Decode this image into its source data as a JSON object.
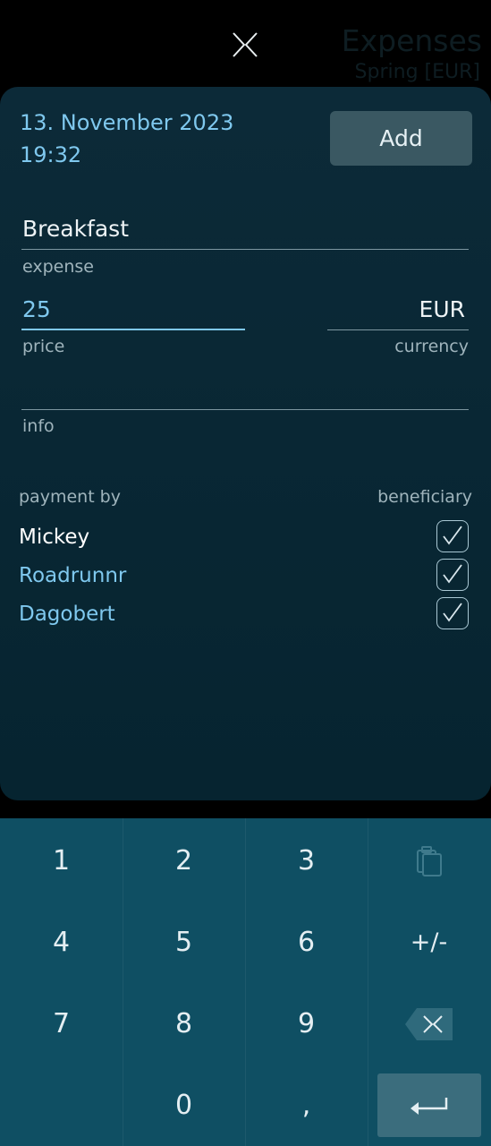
{
  "header": {
    "title": "Expenses",
    "subtitle": "Spring [EUR]",
    "close_icon": "close-icon"
  },
  "dialog": {
    "date": "13. November 2023",
    "time": "19:32",
    "add_label": "Add",
    "expense": {
      "value": "Breakfast",
      "label": "expense"
    },
    "price": {
      "value": "25",
      "label": "price"
    },
    "currency": {
      "value": "EUR",
      "label": "currency"
    },
    "info": {
      "value": "",
      "label": "info"
    },
    "payment_by_label": "payment by",
    "beneficiary_label": "beneficiary",
    "people": [
      {
        "name": "Mickey",
        "payer": true,
        "beneficiary": true
      },
      {
        "name": "Roadrunnr",
        "payer": false,
        "beneficiary": true
      },
      {
        "name": "Dagobert",
        "payer": false,
        "beneficiary": true
      }
    ]
  },
  "keypad": {
    "keys": [
      "1",
      "2",
      "3",
      "paste-icon",
      "4",
      "5",
      "6",
      "+/-",
      "7",
      "8",
      "9",
      "backspace-icon",
      "0",
      ",",
      "enter-icon"
    ],
    "colors": {
      "background": "#0f4f63",
      "enter": "#3b6d7d",
      "accent": "#7fc8ee"
    }
  }
}
